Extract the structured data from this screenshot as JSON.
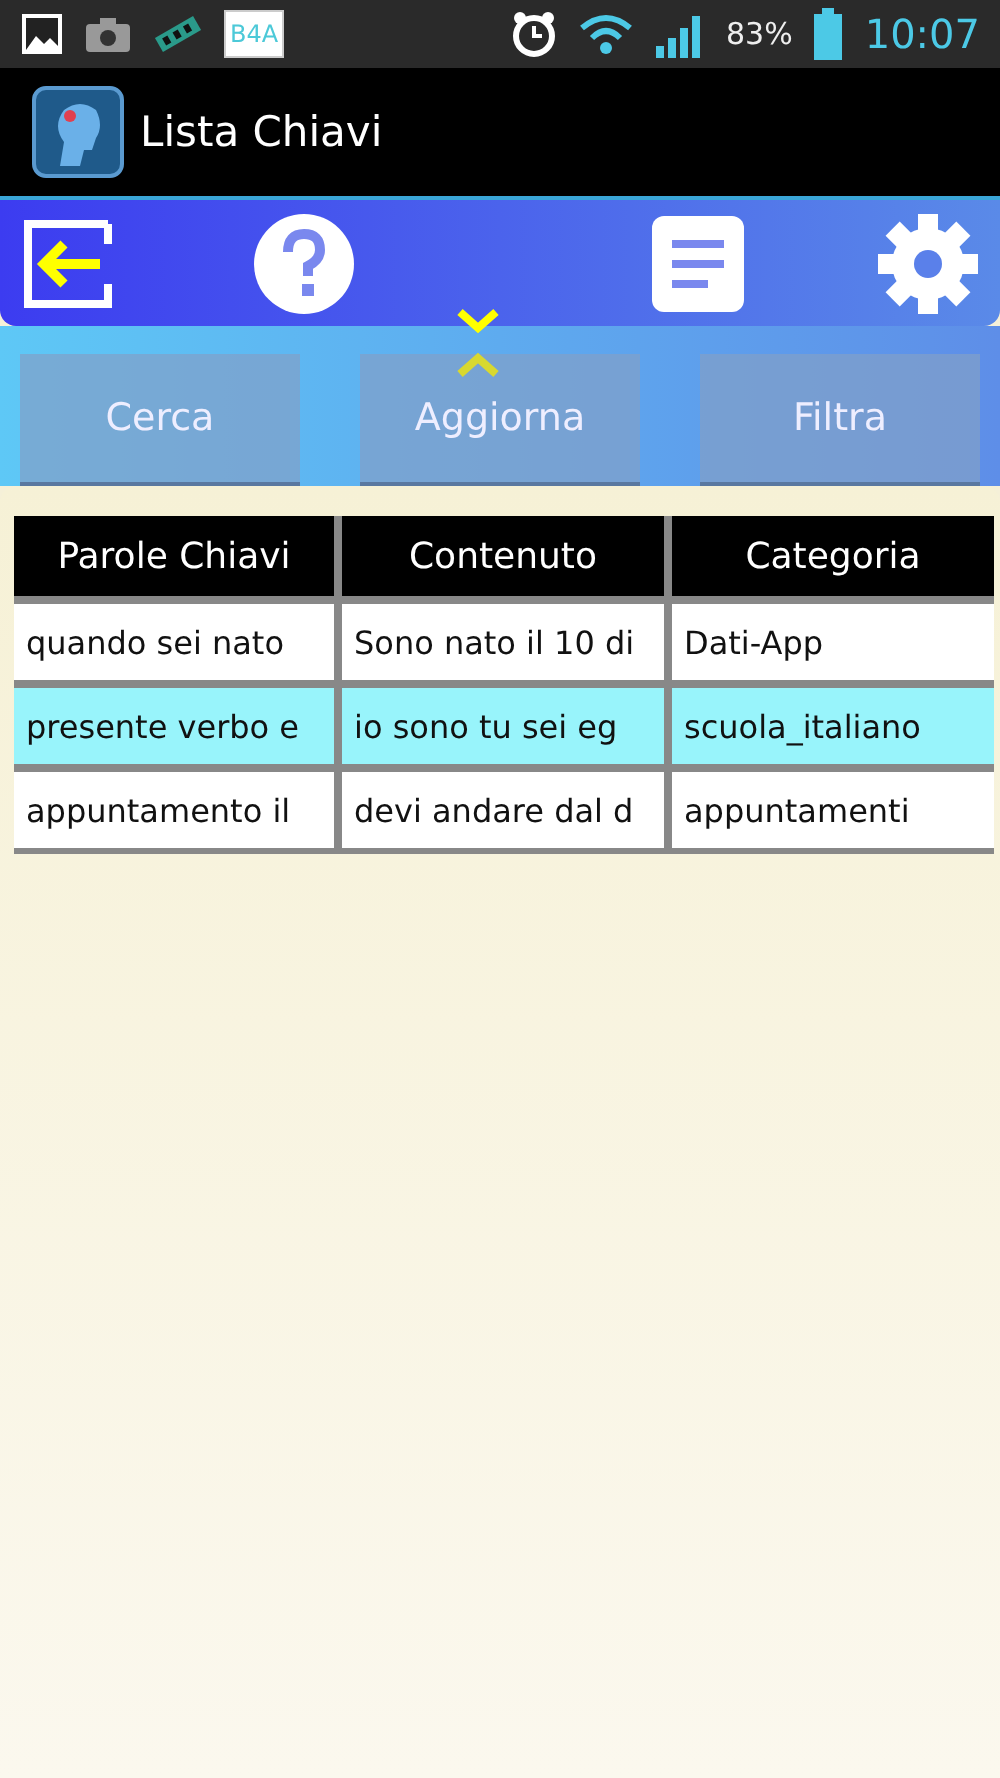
{
  "status_bar": {
    "app_badge": "B4A",
    "battery": "83%",
    "time": "10:07"
  },
  "title_bar": {
    "title": "Lista Chiavi"
  },
  "buttons": [
    "Cerca",
    "Aggiorna",
    "Filtra"
  ],
  "table": {
    "columns": [
      "Parole Chiavi",
      "Contenuto",
      "Categoria"
    ],
    "rows": [
      {
        "cells": [
          "quando sei nato",
          "Sono nato il 10 di",
          "Dati-App"
        ],
        "selected": false
      },
      {
        "cells": [
          "presente verbo e",
          "io sono tu sei  eg",
          "scuola_italiano"
        ],
        "selected": true
      },
      {
        "cells": [
          "appuntamento il",
          "devi andare dal d",
          "appuntamenti"
        ],
        "selected": false
      }
    ]
  }
}
